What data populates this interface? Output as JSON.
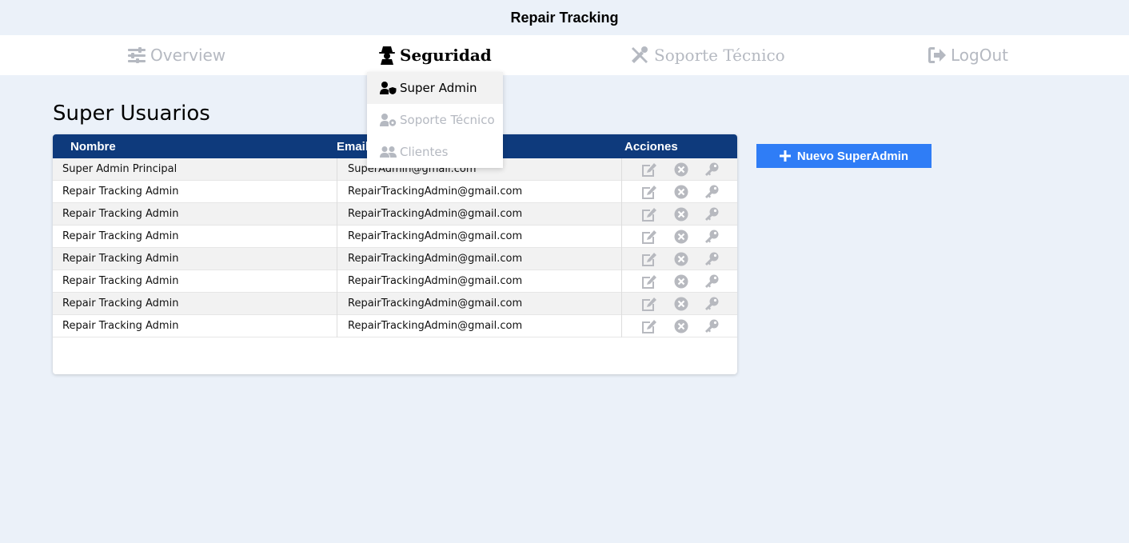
{
  "app": {
    "title": "Repair Tracking"
  },
  "nav": {
    "overview": "Overview",
    "seguridad": "Seguridad",
    "soporte": "Soporte Técnico",
    "logout": "LogOut"
  },
  "dropdown": {
    "items": [
      {
        "label": "Super Admin",
        "icon": "user-shield-icon",
        "active": true
      },
      {
        "label": "Soporte Técnico",
        "icon": "user-gear-icon",
        "active": false
      },
      {
        "label": "Clientes",
        "icon": "users-icon",
        "active": false
      }
    ]
  },
  "page": {
    "title": "Super Usuarios"
  },
  "table": {
    "headers": {
      "nombre": "Nombre",
      "email": "Email",
      "acciones": "Acciones"
    },
    "rows": [
      {
        "nombre": "Super Admin Principal",
        "email": "SuperAdmin@gmail.com"
      },
      {
        "nombre": "Repair Tracking Admin",
        "email": "RepairTrackingAdmin@gmail.com"
      },
      {
        "nombre": "Repair Tracking Admin",
        "email": "RepairTrackingAdmin@gmail.com"
      },
      {
        "nombre": "Repair Tracking Admin",
        "email": "RepairTrackingAdmin@gmail.com"
      },
      {
        "nombre": "Repair Tracking Admin",
        "email": "RepairTrackingAdmin@gmail.com"
      },
      {
        "nombre": "Repair Tracking Admin",
        "email": "RepairTrackingAdmin@gmail.com"
      },
      {
        "nombre": "Repair Tracking Admin",
        "email": "RepairTrackingAdmin@gmail.com"
      },
      {
        "nombre": "Repair Tracking Admin",
        "email": "RepairTrackingAdmin@gmail.com"
      }
    ]
  },
  "actions": {
    "new_label": "Nuevo SuperAdmin"
  },
  "colors": {
    "header_bg": "#0e3a7c",
    "button_bg": "#2f7df6",
    "page_bg": "#ebf1f9",
    "inactive_nav": "#b5b9c1"
  }
}
